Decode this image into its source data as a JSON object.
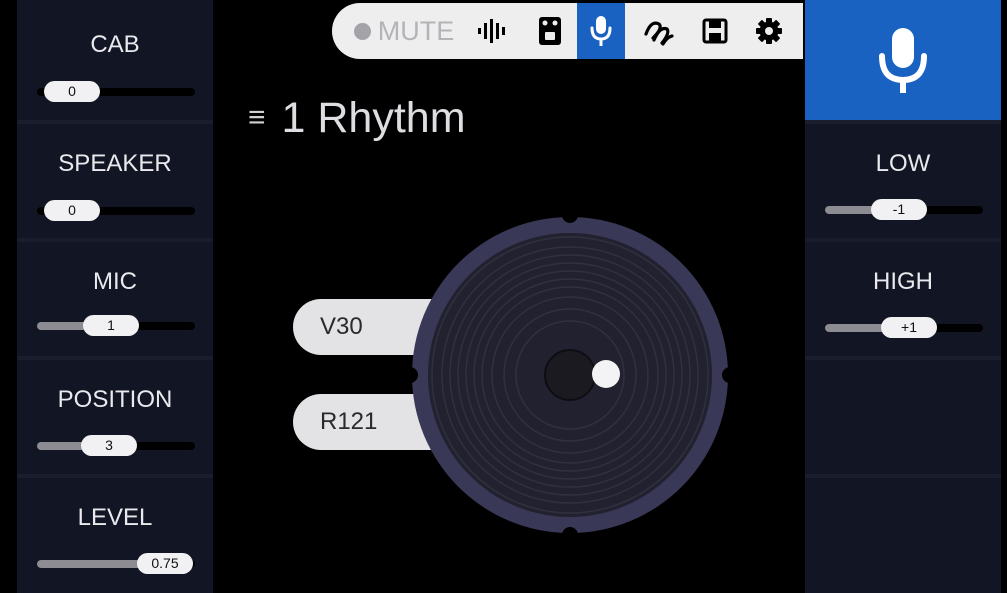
{
  "toolbar": {
    "mute_label": "MUTE",
    "icons": [
      "record-dot-icon",
      "waveform-icon",
      "pedal-icon",
      "microphone-icon",
      "swirl-icon",
      "save-icon",
      "gear-icon"
    ],
    "active_item": "microphone-icon"
  },
  "preset": {
    "menu_glyph": "≡",
    "name": "1 Rhythm"
  },
  "left_panel": [
    {
      "label": "CAB",
      "value": "0",
      "fraction": 0.0
    },
    {
      "label": "SPEAKER",
      "value": "0",
      "fraction": 0.0
    },
    {
      "label": "MIC",
      "value": "1",
      "fraction": 0.3
    },
    {
      "label": "POSITION",
      "value": "3",
      "fraction": 0.3
    },
    {
      "label": "LEVEL",
      "value": "0.75",
      "fraction": 0.75
    }
  ],
  "right_panel": {
    "active_tile_icon": "microphone-icon",
    "controls": [
      {
        "label": "LOW",
        "value": "-1",
        "fraction": 0.5
      },
      {
        "label": "HIGH",
        "value": "+1",
        "fraction": 0.5
      }
    ]
  },
  "speaker_options": [
    "V30",
    "R121"
  ],
  "colors": {
    "accent": "#1a62c2",
    "panel": "#121624",
    "toolbar_bg": "#eeeeef"
  }
}
